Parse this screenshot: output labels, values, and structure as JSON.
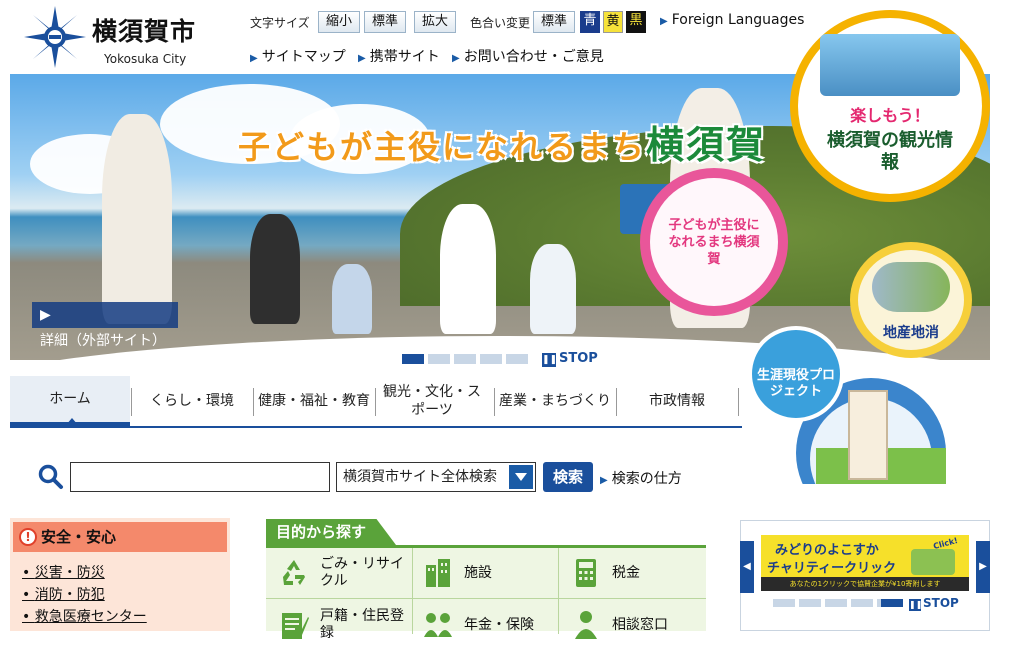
{
  "header": {
    "city_name": "横須賀市",
    "city_name_en": "Yokosuka City",
    "font_size_label": "文字サイズ",
    "font_size_buttons": [
      "縮小",
      "標準",
      "拡大"
    ],
    "color_label": "色合い変更",
    "color_buttons": [
      "標準",
      "青",
      "黄",
      "黒"
    ],
    "foreign_languages": "Foreign Languages",
    "links": [
      "サイトマップ",
      "携帯サイト",
      "お問い合わせ・ご意見"
    ]
  },
  "hero": {
    "title_part1": "子どもが主役になれるまち",
    "title_part2": "横須賀",
    "detail_button": "詳細（外部サイト）",
    "badge_child": "子どもが主役になれるまち横須賀",
    "badge_tourism_top": "楽しもう！",
    "badge_tourism_bottom": "横須賀の観光情報",
    "badge_local": "地産地消",
    "badge_lifelong": "生涯現役プロジェクト",
    "stop_label": "STOP"
  },
  "nav": {
    "items": [
      "ホーム",
      "くらし・環境",
      "健康・福祉・教育",
      "観光・文化・スポーツ",
      "産業・まちづくり",
      "市政情報"
    ]
  },
  "search": {
    "input_value": "",
    "scope_selected": "横須賀市サイト全体検索",
    "button_label": "検索",
    "help_link": "検索の仕方"
  },
  "safety": {
    "heading": "安全・安心",
    "links": [
      "災害・防災",
      "消防・防犯",
      "救急医療センター"
    ]
  },
  "purpose": {
    "tab_label": "目的から探す",
    "items": [
      "ごみ・リサイクル",
      "施設",
      "税金",
      "戸籍・住民登録",
      "年金・保険",
      "相談窓口"
    ]
  },
  "banner": {
    "title_line1": "みどりのよこすか",
    "title_line2": "チャリティークリック",
    "click_label": "Click!",
    "subtext": "あなたの1クリックで協賛企業が¥10寄附します",
    "stop_label": "STOP"
  },
  "colors": {
    "accent": "#1a4f9c",
    "nav_active": "#1a4f9c",
    "safety_head": "#f4896b",
    "purpose_green": "#5aa33a"
  }
}
